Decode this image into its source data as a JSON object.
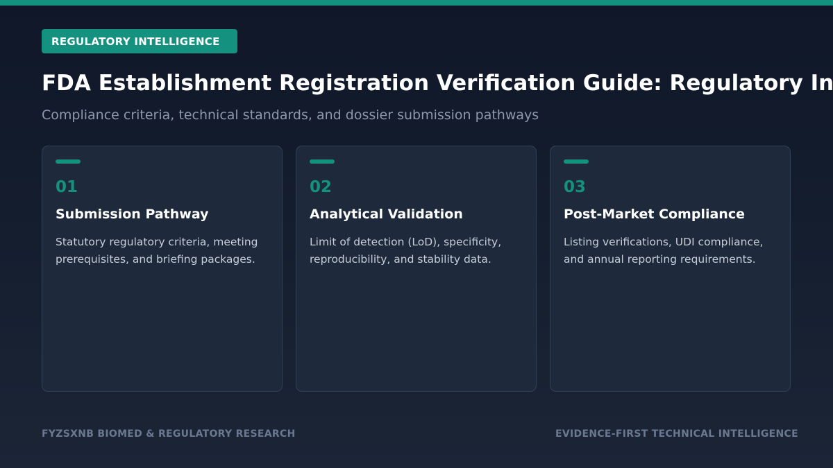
{
  "colors": {
    "accent": "#14917f",
    "background": "#0f1729",
    "card_background": "#1e293b",
    "card_border": "#334155",
    "subtitle": "#8d99ac",
    "footer": "#6b7891"
  },
  "badge": {
    "label": "REGULATORY INTELLIGENCE"
  },
  "header": {
    "title": "FDA Establishment Registration Verification Guide: Regulatory Intelligence",
    "subtitle": "Compliance criteria, technical standards, and dossier submission pathways"
  },
  "cards": [
    {
      "number": "01",
      "title": "Submission Pathway",
      "description": "Statutory regulatory criteria, meeting prerequisites, and briefing packages."
    },
    {
      "number": "02",
      "title": "Analytical Validation",
      "description": "Limit of detection (LoD), specificity, reproducibility, and stability data."
    },
    {
      "number": "03",
      "title": "Post-Market Compliance",
      "description": "Listing verifications, UDI compliance, and annual reporting requirements."
    }
  ],
  "footer": {
    "left": "FYZSXNB BIOMED & REGULATORY RESEARCH",
    "right": "EVIDENCE-FIRST TECHNICAL INTELLIGENCE"
  }
}
